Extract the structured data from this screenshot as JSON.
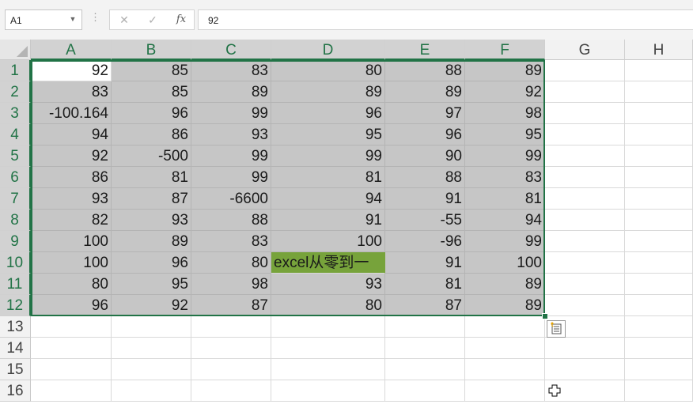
{
  "formula_bar": {
    "name_box": "A1",
    "formula": "92"
  },
  "columns": [
    "A",
    "B",
    "C",
    "D",
    "E",
    "F",
    "G",
    "H"
  ],
  "rows": [
    "1",
    "2",
    "3",
    "4",
    "5",
    "6",
    "7",
    "8",
    "9",
    "10",
    "11",
    "12",
    "13",
    "14",
    "15",
    "16"
  ],
  "cells": [
    [
      "92",
      "85",
      "83",
      "80",
      "88",
      "89"
    ],
    [
      "83",
      "85",
      "89",
      "89",
      "89",
      "92"
    ],
    [
      "-100.164",
      "96",
      "99",
      "96",
      "97",
      "98"
    ],
    [
      "94",
      "86",
      "93",
      "95",
      "96",
      "95"
    ],
    [
      "92",
      "-500",
      "99",
      "99",
      "90",
      "99"
    ],
    [
      "86",
      "81",
      "99",
      "81",
      "88",
      "83"
    ],
    [
      "93",
      "87",
      "-6600",
      "94",
      "91",
      "81"
    ],
    [
      "82",
      "93",
      "88",
      "91",
      "-55",
      "94"
    ],
    [
      "100",
      "89",
      "83",
      "100",
      "-96",
      "99"
    ],
    [
      "100",
      "96",
      "80",
      "excel从零到一",
      "91",
      "100"
    ],
    [
      "80",
      "95",
      "98",
      "93",
      "81",
      "89"
    ],
    [
      "96",
      "92",
      "87",
      "80",
      "87",
      "89"
    ]
  ],
  "selection": {
    "range": "A1:F12",
    "active_cell": "A1"
  },
  "colors": {
    "selection_border": "#217346",
    "selection_fill": "#c6c6c6",
    "highlight_cell": "#77a33b"
  },
  "icons": {
    "quick_analysis": "quick-analysis-icon",
    "cursor": "crosshair-cursor-icon"
  }
}
